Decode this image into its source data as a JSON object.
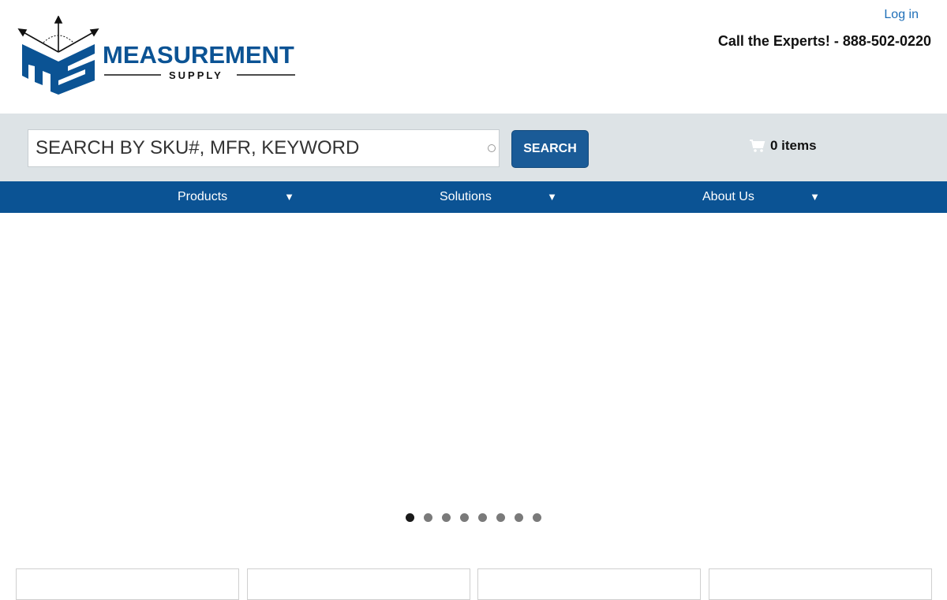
{
  "header": {
    "logo": {
      "brand_main": "MEASUREMENT",
      "brand_sub": "SUPPLY",
      "brand_color": "#0b5394"
    },
    "login_label": "Log in",
    "phone_text": "Call the Experts! - 888-502-0220"
  },
  "search": {
    "placeholder": "SEARCH BY SKU#, MFR, KEYWORD",
    "button_label": "SEARCH"
  },
  "cart": {
    "icon": "cart-icon",
    "label": "0 items"
  },
  "nav": {
    "items": [
      {
        "label": "Products",
        "caret": "▼"
      },
      {
        "label": "Solutions",
        "caret": "▼"
      },
      {
        "label": "About Us",
        "caret": "▼"
      }
    ]
  },
  "carousel": {
    "slide_count": 8,
    "active_index": 0
  },
  "colors": {
    "nav_bg": "#0b5394",
    "search_band_bg": "#dde3e6",
    "button_bg": "#1a5b97",
    "link": "#1f6fb8"
  }
}
